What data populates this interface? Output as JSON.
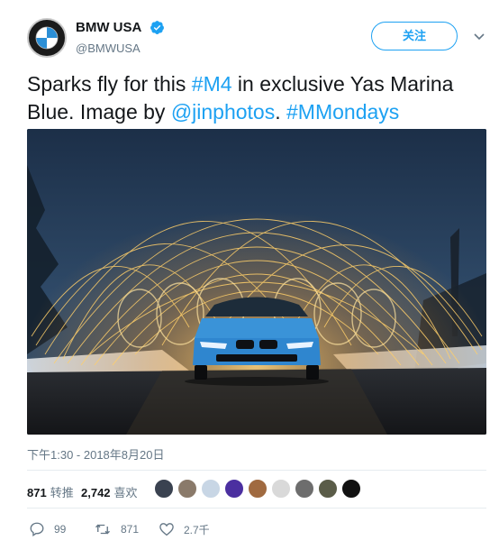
{
  "account": {
    "display_name": "BMW USA",
    "handle": "@BMWUSA",
    "verified": true,
    "avatar_icon": "bmw-roundel-icon"
  },
  "header": {
    "follow_label": "关注",
    "menu_icon": "chevron-down-icon"
  },
  "tweet": {
    "segments": [
      {
        "text": "Sparks fly for this ",
        "link": false
      },
      {
        "text": "#M4",
        "link": true
      },
      {
        "text": " in exclusive Yas Marina Blue. Image by ",
        "link": false
      },
      {
        "text": "@jinphotos",
        "link": true
      },
      {
        "text": ". ",
        "link": false
      },
      {
        "text": "#MMondays",
        "link": true
      }
    ],
    "image_alt": "Blue BMW M4 under an arc of steel-wool sparks at dusk",
    "timestamp": "下午1:30 - 2018年8月20日"
  },
  "stats": {
    "retweets_count": "871",
    "retweets_label": "转推",
    "likes_count": "2,742",
    "likes_label": "喜欢"
  },
  "likers": {
    "colors": [
      "#3a4250",
      "#8a7a6a",
      "#c8d6e5",
      "#4b2fa0",
      "#a06a40",
      "#d9d9d9",
      "#6d6d6d",
      "#5a5c48",
      "#111111"
    ]
  },
  "actions": {
    "reply_count": "99",
    "retweet_count": "871",
    "like_count": "2.7千"
  },
  "colors": {
    "link": "#1da1f2",
    "text": "#14171a",
    "muted": "#657786"
  }
}
